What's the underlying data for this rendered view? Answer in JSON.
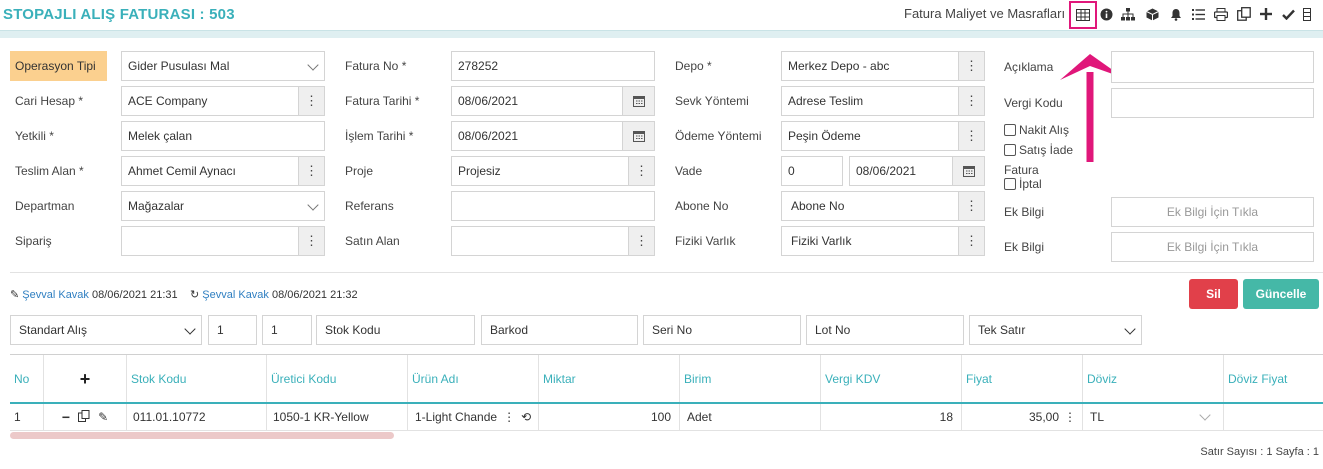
{
  "header": {
    "title": "STOPAJLI ALIŞ FATURASI : 503",
    "cost_link": "Fatura Maliyet ve Masrafları",
    "toolbar_icons": [
      "table-icon",
      "info-icon",
      "sitemap-icon",
      "cube-icon",
      "bell-icon",
      "list-icon",
      "print-icon",
      "copy-icon",
      "plus-icon",
      "check-icon",
      "columns-icon"
    ]
  },
  "form": {
    "operasyon_tipi": {
      "label": "Operasyon Tipi",
      "value": "Gider Pusulası Mal"
    },
    "cari_hesap": {
      "label": "Cari Hesap *",
      "value": "ACE Company"
    },
    "yetkili": {
      "label": "Yetkili *",
      "value": "Melek çalan"
    },
    "teslim_alan": {
      "label": "Teslim Alan *",
      "value": "Ahmet Cemil Aynacı"
    },
    "departman": {
      "label": "Departman",
      "value": "Mağazalar"
    },
    "siparis": {
      "label": "Sipariş",
      "value": ""
    },
    "fatura_no": {
      "label": "Fatura No *",
      "value": "278252"
    },
    "fatura_tarihi": {
      "label": "Fatura Tarihi *",
      "value": "08/06/2021"
    },
    "islem_tarihi": {
      "label": "İşlem Tarihi *",
      "value": "08/06/2021"
    },
    "proje": {
      "label": "Proje",
      "value": "Projesiz"
    },
    "referans": {
      "label": "Referans",
      "value": ""
    },
    "satin_alan": {
      "label": "Satın Alan",
      "value": ""
    },
    "depo": {
      "label": "Depo *",
      "value": "Merkez Depo - abc"
    },
    "sevk_yontemi": {
      "label": "Sevk Yöntemi",
      "value": "Adrese Teslim"
    },
    "odeme_yontemi": {
      "label": "Ödeme Yöntemi",
      "value": "Peşin Ödeme"
    },
    "vade": {
      "label": "Vade",
      "days": "0",
      "date": "08/06/2021"
    },
    "abone_no": {
      "label": "Abone No",
      "placeholder": "Abone No"
    },
    "fiziki_varlik": {
      "label": "Fiziki Varlık",
      "placeholder": "Fiziki Varlık"
    },
    "aciklama": {
      "label": "Açıklama",
      "value": ""
    },
    "vergi_kodu": {
      "label": "Vergi Kodu",
      "value": ""
    },
    "nakit_alis": "Nakit Alış",
    "satis_iade": "Satış İade",
    "fatura_iptal_top": "Fatura",
    "fatura_iptal": "İptal",
    "ek_bilgi_1": {
      "label": "Ek Bilgi",
      "placeholder": "Ek Bilgi İçin Tıkla"
    },
    "ek_bilgi_2": {
      "label": "Ek Bilgi",
      "placeholder": "Ek Bilgi İçin Tıkla"
    }
  },
  "audit": {
    "created_user": "Şevval Kavak",
    "created_at": "08/06/2021 21:31",
    "updated_user": "Şevval Kavak",
    "updated_at": "08/06/2021 21:32"
  },
  "buttons": {
    "delete": "Sil",
    "update": "Güncelle"
  },
  "entry_bar": {
    "sale_type": "Standart Alış",
    "qty1": "1",
    "qty2": "1",
    "stock_code_ph": "Stok Kodu",
    "barcode_ph": "Barkod",
    "serial_ph": "Seri No",
    "lot_ph": "Lot No",
    "row_mode": "Tek Satır"
  },
  "table": {
    "headers": [
      "No",
      "+",
      "Stok Kodu",
      "Üretici Kodu",
      "Ürün Adı",
      "Miktar",
      "Birim",
      "Vergi KDV",
      "Fiyat",
      "Döviz",
      "Döviz Fiyat"
    ],
    "rows": [
      {
        "no": "1",
        "stock_code": "011.01.10772",
        "maker_code": "1050-1 KR-Yellow",
        "product": "1-Light Chande",
        "qty": "100",
        "unit": "Adet",
        "tax": "18",
        "price": "35,00",
        "currency": "TL",
        "fx_price": ""
      }
    ]
  },
  "footer": {
    "summary": "Satır Sayısı : 1 Sayfa : 1"
  },
  "colors": {
    "accent": "#3ab0ba",
    "highlight": "#e0177a",
    "danger": "#e1404a",
    "success": "#45b8a7",
    "op_label": "#fbd08f"
  }
}
